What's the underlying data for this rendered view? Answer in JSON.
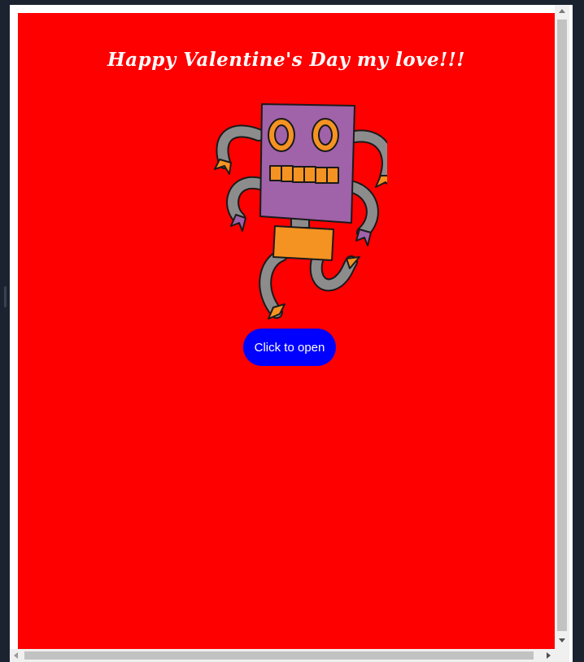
{
  "page": {
    "title": "Happy Valentine's Day my love!!!",
    "button_label": "Click to open",
    "robot_image": "robot-illustration"
  },
  "colors": {
    "background": "#ff0000",
    "title_text": "#ffffff",
    "button_background": "#0000ff",
    "button_text": "#ffffff",
    "robot_head": "#a062a8",
    "robot_accent": "#f59322",
    "robot_limbs": "#8c8c8c"
  }
}
